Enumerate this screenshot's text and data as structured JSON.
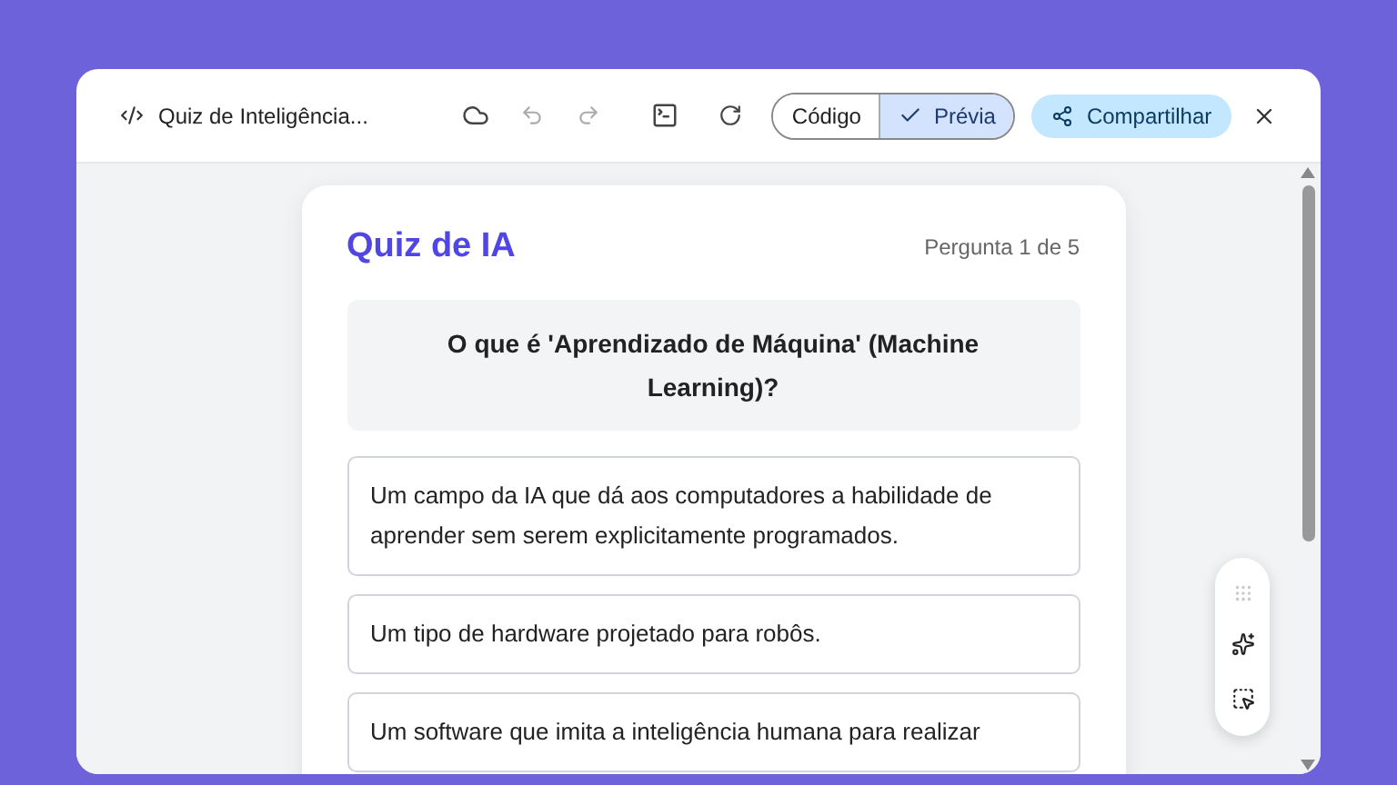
{
  "window": {
    "title": "Quiz de Inteligência..."
  },
  "view_toggle": [
    {
      "label": "Código",
      "selected": false
    },
    {
      "label": "Prévia",
      "selected": true
    }
  ],
  "share_button": {
    "label": "Compartilhar"
  },
  "quiz": {
    "title": "Quiz de IA",
    "progress": "Pergunta 1 de 5",
    "question": "O que é 'Aprendizado de Máquina' (Machine Learning)?",
    "options": [
      {
        "text": "Um campo da IA que dá aos computadores a habilidade de aprender sem serem explicitamente programados.",
        "selected": false
      },
      {
        "text": "Um tipo de hardware projetado para robôs.",
        "selected": false
      },
      {
        "text": "Um software que imita a inteligência humana para realizar",
        "selected": false
      }
    ]
  }
}
